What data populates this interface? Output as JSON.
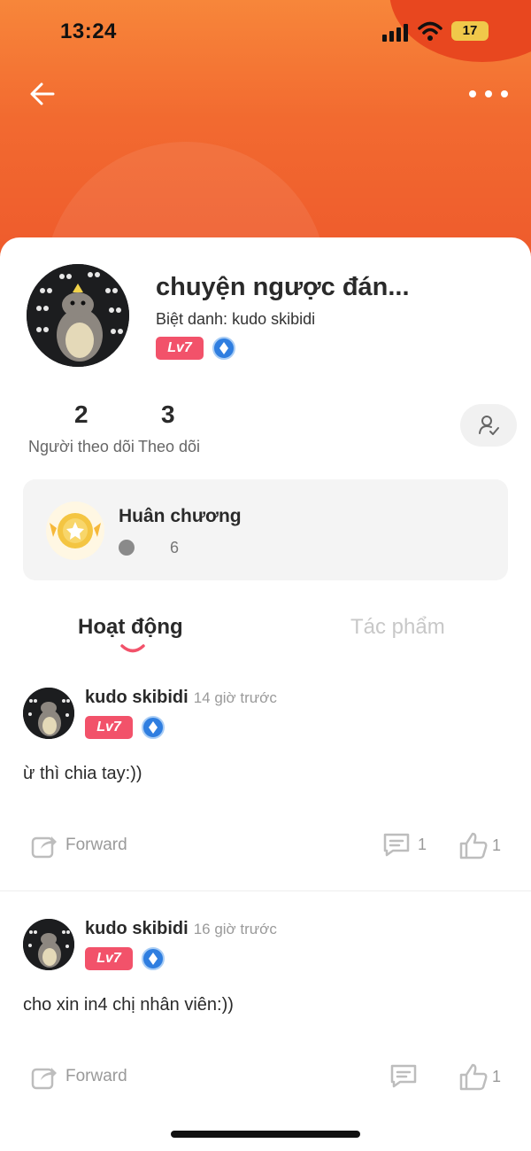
{
  "status_bar": {
    "time": "13:24",
    "battery": "17"
  },
  "profile": {
    "name": "chuyện ngược đán...",
    "nickname": "Biệt danh: kudo skibidi",
    "level_badge": "Lv7"
  },
  "stats": {
    "followers_count": "2",
    "followers_label": "Người theo dõi",
    "following_count": "3",
    "following_label": "Theo dõi"
  },
  "medal": {
    "title": "Huân chương",
    "count": "6"
  },
  "tabs": [
    {
      "label": "Hoạt động",
      "active": true
    },
    {
      "label": "Tác phẩm",
      "active": false
    }
  ],
  "posts": [
    {
      "author": "kudo skibidi",
      "time": "14 giờ trước",
      "level": "Lv7",
      "text": "ừ thì chia tay:))",
      "forward_label": "Forward",
      "comments": "1",
      "likes": "1"
    },
    {
      "author": "kudo skibidi",
      "time": "16 giờ trước",
      "level": "Lv7",
      "text": "cho xin in4 chị nhân viên:))",
      "forward_label": "Forward",
      "comments": "",
      "likes": "1"
    }
  ],
  "colors": {
    "hero_orange": "#f26a30",
    "level_badge": "#f2526a",
    "tab_indicator": "#f2526a",
    "gem_blue": "#2f7ee0"
  },
  "icons": [
    "back-arrow-icon",
    "more-dots-icon",
    "follow-check-icon",
    "medal-icon",
    "forward-icon",
    "comment-icon",
    "like-icon"
  ]
}
